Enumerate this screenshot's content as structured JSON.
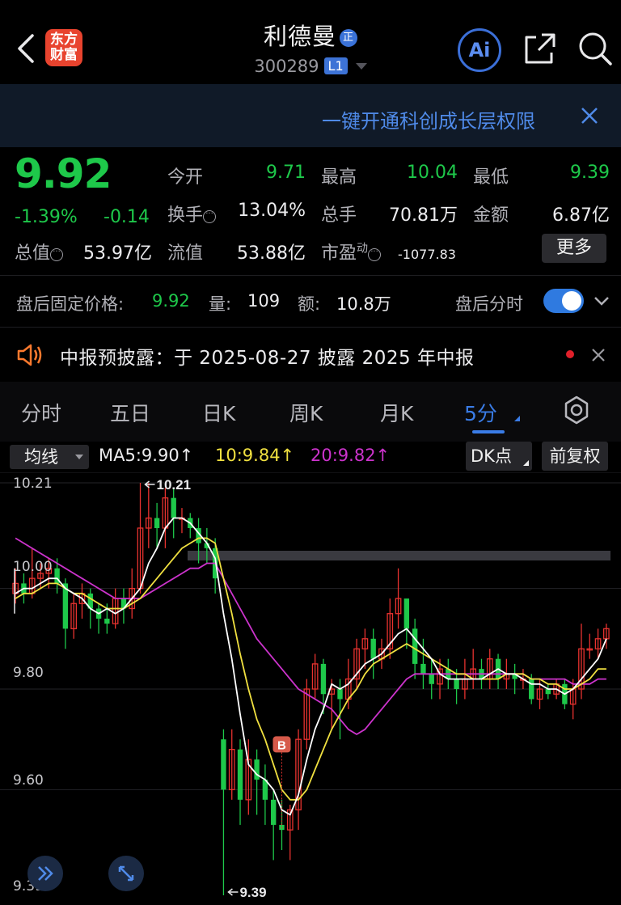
{
  "header": {
    "logo_text": "东方财富",
    "stock_name": "利德曼",
    "name_badge": "正",
    "stock_code": "300289",
    "level_badge": "L1",
    "ai_label": "Ai"
  },
  "banner": {
    "text": "一键开通科创成长层权限"
  },
  "quote": {
    "price": "9.92",
    "change_pct": "-1.39%",
    "change": "-0.14",
    "fields": {
      "open_label": "今开",
      "open_value": "9.71",
      "high_label": "最高",
      "high_value": "10.04",
      "low_label": "最低",
      "low_value": "9.39",
      "turnover_label": "换手",
      "turnover_value": "13.04%",
      "volume_label": "总手",
      "volume_value": "70.81万",
      "amount_label": "金额",
      "amount_value": "6.87亿",
      "mktcap_label": "总值",
      "mktcap_value": "53.97亿",
      "float_label": "流值",
      "float_value": "53.88亿",
      "pe_label": "市盈",
      "pe_sup": "动",
      "pe_value": "-1077.83"
    },
    "more_label": "更多"
  },
  "after_hours": {
    "label": "盘后固定价格:",
    "price": "9.92",
    "vol_label": "量:",
    "vol": "109",
    "amt_label": "额:",
    "amt": "10.8万",
    "toggle_label": "盘后分时",
    "toggle_on": true
  },
  "announcement": {
    "text": "中报预披露：于 2025-08-27 披露 2025 年中报"
  },
  "tabs": [
    {
      "label": "分时",
      "active": false
    },
    {
      "label": "五日",
      "active": false
    },
    {
      "label": "日K",
      "active": false
    },
    {
      "label": "周K",
      "active": false
    },
    {
      "label": "月K",
      "active": false
    },
    {
      "label": "5分",
      "active": true
    }
  ],
  "chart_toolbar": {
    "indicator": "均线",
    "ma5": "MA5:9.90↑",
    "ma10": "10:9.84↑",
    "ma20": "20:9.82↑",
    "dk_label": "DK点",
    "fq_label": "前复权"
  },
  "colors": {
    "up": "#e8322f",
    "down": "#1ec84a",
    "ma5": "#ffffff",
    "ma10": "#f0e040",
    "ma20": "#cc33cc",
    "accent": "#3a7ce6"
  },
  "chart_data": {
    "type": "candlestick",
    "y_ticks": [
      "10.21",
      "10.00",
      "9.80",
      "9.60",
      "9.39"
    ],
    "ylim": [
      9.39,
      10.21
    ],
    "high_annotation": "10.21",
    "low_annotation": "9.39",
    "signal_label": "B",
    "candles": [
      [
        9.99,
        10.01,
        9.97,
        10.04
      ],
      [
        10.01,
        9.99,
        9.97,
        10.03
      ],
      [
        9.99,
        10.02,
        9.98,
        10.08
      ],
      [
        10.02,
        10.03,
        10.0,
        10.05
      ],
      [
        10.03,
        10.04,
        10.0,
        10.06
      ],
      [
        10.04,
        10.01,
        9.99,
        10.06
      ],
      [
        10.01,
        9.92,
        9.88,
        10.02
      ],
      [
        9.92,
        9.97,
        9.9,
        9.99
      ],
      [
        9.97,
        9.99,
        9.94,
        10.01
      ],
      [
        9.99,
        9.96,
        9.92,
        10.0
      ],
      [
        9.96,
        9.94,
        9.91,
        9.97
      ],
      [
        9.94,
        9.93,
        9.91,
        9.97
      ],
      [
        9.93,
        9.98,
        9.92,
        10.0
      ],
      [
        9.98,
        9.96,
        9.93,
        10.0
      ],
      [
        9.96,
        10.0,
        9.94,
        10.04
      ],
      [
        10.0,
        10.12,
        9.99,
        10.21
      ],
      [
        10.12,
        10.14,
        10.08,
        10.21
      ],
      [
        10.14,
        10.12,
        10.08,
        10.17
      ],
      [
        10.12,
        10.18,
        10.08,
        10.2
      ],
      [
        10.18,
        10.14,
        10.1,
        10.2
      ],
      [
        10.14,
        10.14,
        10.11,
        10.16
      ],
      [
        10.14,
        10.12,
        10.1,
        10.15
      ],
      [
        10.12,
        10.09,
        10.05,
        10.14
      ],
      [
        10.09,
        10.08,
        10.05,
        10.12
      ],
      [
        10.08,
        10.02,
        9.99,
        10.1
      ],
      [
        9.7,
        9.6,
        9.39,
        9.72
      ],
      [
        9.6,
        9.68,
        9.58,
        9.72
      ],
      [
        9.68,
        9.58,
        9.53,
        9.7
      ],
      [
        9.58,
        9.66,
        9.55,
        9.7
      ],
      [
        9.66,
        9.62,
        9.55,
        9.68
      ],
      [
        9.62,
        9.58,
        9.53,
        9.65
      ],
      [
        9.58,
        9.53,
        9.46,
        9.6
      ],
      [
        9.53,
        9.52,
        9.48,
        9.58
      ],
      [
        9.52,
        9.56,
        9.46,
        9.57
      ],
      [
        9.56,
        9.7,
        9.52,
        9.72
      ],
      [
        9.7,
        9.8,
        9.68,
        9.82
      ],
      [
        9.8,
        9.85,
        9.78,
        9.87
      ],
      [
        9.85,
        9.79,
        9.75,
        9.86
      ],
      [
        9.79,
        9.8,
        9.72,
        9.82
      ],
      [
        9.8,
        9.78,
        9.7,
        9.82
      ],
      [
        9.78,
        9.82,
        9.76,
        9.86
      ],
      [
        9.82,
        9.88,
        9.8,
        9.9
      ],
      [
        9.88,
        9.9,
        9.84,
        9.92
      ],
      [
        9.9,
        9.86,
        9.82,
        9.92
      ],
      [
        9.86,
        9.88,
        9.84,
        9.9
      ],
      [
        9.88,
        9.95,
        9.86,
        9.98
      ],
      [
        9.95,
        9.98,
        9.92,
        10.04
      ],
      [
        9.98,
        9.92,
        9.88,
        9.98
      ],
      [
        9.92,
        9.85,
        9.82,
        9.94
      ],
      [
        9.85,
        9.83,
        9.8,
        9.9
      ],
      [
        9.83,
        9.81,
        9.78,
        9.86
      ],
      [
        9.81,
        9.84,
        9.78,
        9.86
      ],
      [
        9.84,
        9.82,
        9.8,
        9.86
      ],
      [
        9.82,
        9.8,
        9.77,
        9.84
      ],
      [
        9.8,
        9.82,
        9.78,
        9.86
      ],
      [
        9.82,
        9.84,
        9.8,
        9.88
      ],
      [
        9.84,
        9.82,
        9.8,
        9.86
      ],
      [
        9.82,
        9.86,
        9.8,
        9.88
      ],
      [
        9.86,
        9.82,
        9.8,
        9.87
      ],
      [
        9.82,
        9.83,
        9.8,
        9.86
      ],
      [
        9.83,
        9.82,
        9.79,
        9.85
      ],
      [
        9.82,
        9.82,
        9.8,
        9.84
      ],
      [
        9.82,
        9.78,
        9.77,
        9.83
      ],
      [
        9.78,
        9.8,
        9.76,
        9.82
      ],
      [
        9.8,
        9.79,
        9.78,
        9.81
      ],
      [
        9.79,
        9.81,
        9.78,
        9.82
      ],
      [
        9.81,
        9.77,
        9.76,
        9.82
      ],
      [
        9.77,
        9.8,
        9.74,
        9.82
      ],
      [
        9.8,
        9.88,
        9.78,
        9.93
      ],
      [
        9.88,
        9.88,
        9.86,
        9.91
      ],
      [
        9.88,
        9.9,
        9.86,
        9.92
      ],
      [
        9.9,
        9.92,
        9.88,
        9.93
      ]
    ],
    "ma5": [
      9.99,
      10.0,
      10.0,
      10.01,
      10.02,
      10.02,
      10.0,
      9.99,
      9.98,
      9.96,
      9.95,
      9.96,
      9.95,
      9.96,
      9.98,
      10.0,
      10.05,
      10.08,
      10.12,
      10.14,
      10.14,
      10.13,
      10.11,
      10.09,
      10.06,
      9.95,
      9.86,
      9.75,
      9.65,
      9.63,
      9.62,
      9.6,
      9.56,
      9.55,
      9.59,
      9.66,
      9.72,
      9.76,
      9.81,
      9.8,
      9.81,
      9.83,
      9.85,
      9.86,
      9.87,
      9.89,
      9.91,
      9.92,
      9.9,
      9.88,
      9.86,
      9.83,
      9.82,
      9.82,
      9.82,
      9.82,
      9.82,
      9.83,
      9.84,
      9.83,
      9.83,
      9.82,
      9.81,
      9.81,
      9.8,
      9.8,
      9.79,
      9.8,
      9.82,
      9.84,
      9.86,
      9.9
    ],
    "ma10": [
      9.98,
      9.99,
      9.99,
      10.0,
      10.01,
      10.01,
      10.0,
      9.99,
      9.99,
      9.98,
      9.97,
      9.96,
      9.96,
      9.96,
      9.97,
      9.98,
      10.0,
      10.02,
      10.04,
      10.06,
      10.08,
      10.09,
      10.1,
      10.1,
      10.09,
      10.02,
      9.95,
      9.87,
      9.8,
      9.74,
      9.7,
      9.65,
      9.6,
      9.58,
      9.58,
      9.6,
      9.64,
      9.68,
      9.72,
      9.75,
      9.78,
      9.8,
      9.83,
      9.85,
      9.86,
      9.87,
      9.88,
      9.89,
      9.88,
      9.87,
      9.86,
      9.85,
      9.84,
      9.83,
      9.83,
      9.82,
      9.82,
      9.82,
      9.82,
      9.83,
      9.83,
      9.83,
      9.82,
      9.82,
      9.81,
      9.81,
      9.8,
      9.8,
      9.81,
      9.82,
      9.84,
      9.84
    ],
    "ma20": [
      10.1,
      10.09,
      10.08,
      10.07,
      10.06,
      10.05,
      10.04,
      10.03,
      10.02,
      10.01,
      10.0,
      9.99,
      9.98,
      9.98,
      9.98,
      9.98,
      9.99,
      10.0,
      10.01,
      10.02,
      10.03,
      10.04,
      10.04,
      10.05,
      10.05,
      10.02,
      9.99,
      9.96,
      9.93,
      9.9,
      9.88,
      9.86,
      9.84,
      9.82,
      9.8,
      9.79,
      9.78,
      9.77,
      9.76,
      9.74,
      9.72,
      9.71,
      9.72,
      9.74,
      9.76,
      9.78,
      9.8,
      9.82,
      9.83,
      9.83,
      9.83,
      9.83,
      9.83,
      9.83,
      9.83,
      9.83,
      9.83,
      9.83,
      9.83,
      9.83,
      9.83,
      9.83,
      9.82,
      9.82,
      9.82,
      9.82,
      9.82,
      9.81,
      9.81,
      9.81,
      9.82,
      9.82
    ]
  }
}
